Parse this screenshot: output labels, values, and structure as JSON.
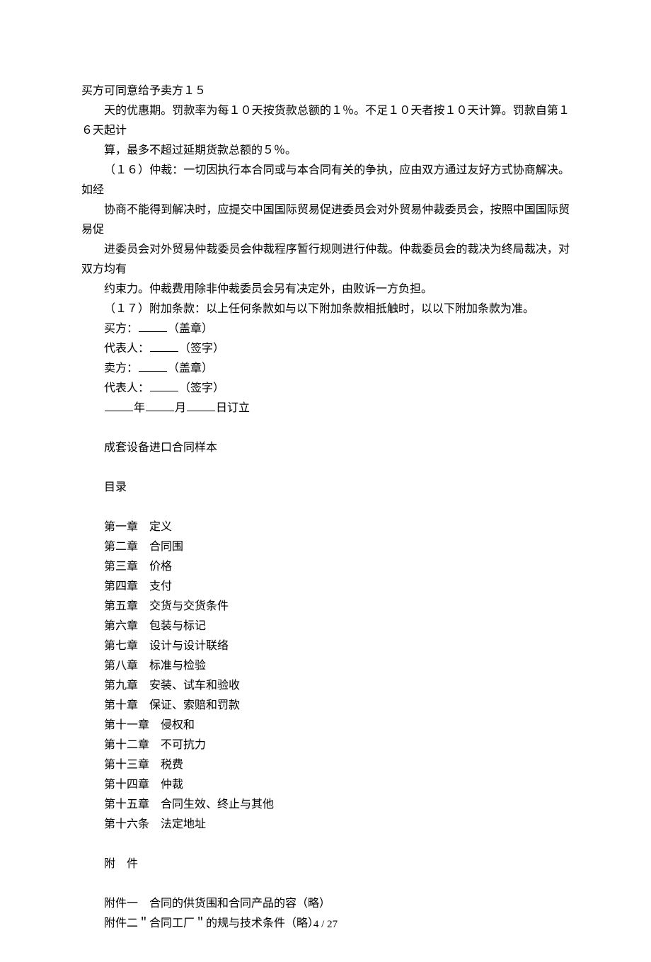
{
  "body": {
    "p1": "买方可同意给予卖方１５",
    "p2": "天的优惠期。罚款率为每１０天按货款总额的１％。不足１０天者按１０天计算。罚款自第１６天起计",
    "p3": "算，最多不超过延期货款总额的５％。",
    "p4": "（１６）仲裁：一切因执行本合同或与本合同有关的争执，应由双方通过友好方式协商解决。如经",
    "p5": "协商不能得到解决时，应提交中国国际贸易促进委员会对外贸易仲裁委员会，按照中国国际贸易促",
    "p6": "进委员会对外贸易仲裁委员会仲裁程序暂行规则进行仲裁。仲裁委员会的裁决为终局裁决，对双方均有",
    "p7": "约束力。仲裁费用除非仲裁委员会另有决定外，由败诉一方负担。",
    "p8": "（１７）附加条款：以上任何条款如与以下附加条款相抵触时，以以下附加条款为准。",
    "buyer_label": "买方：",
    "stamp_label": "（盖章）",
    "rep_label": "代表人：",
    "sign_label": "（签字）",
    "seller_label": "卖方：",
    "year": "年",
    "month": "月",
    "day_sign": "日订立",
    "sample_title": "成套设备进口合同样本",
    "toc_title": "目录",
    "chapters": [
      "第一章　定义",
      "第二章　合同围",
      "第三章　价格",
      "第四章　支付",
      "第五章　交货与交货条件",
      "第六章　包装与标记",
      "第七章　设计与设计联络",
      "第八章　标准与检验",
      "第九章　安装、试车和验收",
      "第十章　保证、索赔和罚款",
      "第十一章　侵权和",
      "第十二章　不可抗力",
      "第十三章　税费",
      "第十四章　仲裁",
      "第十五章　合同生效、终止与其他",
      "第十六条　法定地址"
    ],
    "annex_title": "附　件",
    "annex1": "附件一　合同的供货围和合同产品的容（略）",
    "annex2": "附件二＂合同工厂＂的规与技术条件（略）"
  },
  "footer": "4 / 27"
}
